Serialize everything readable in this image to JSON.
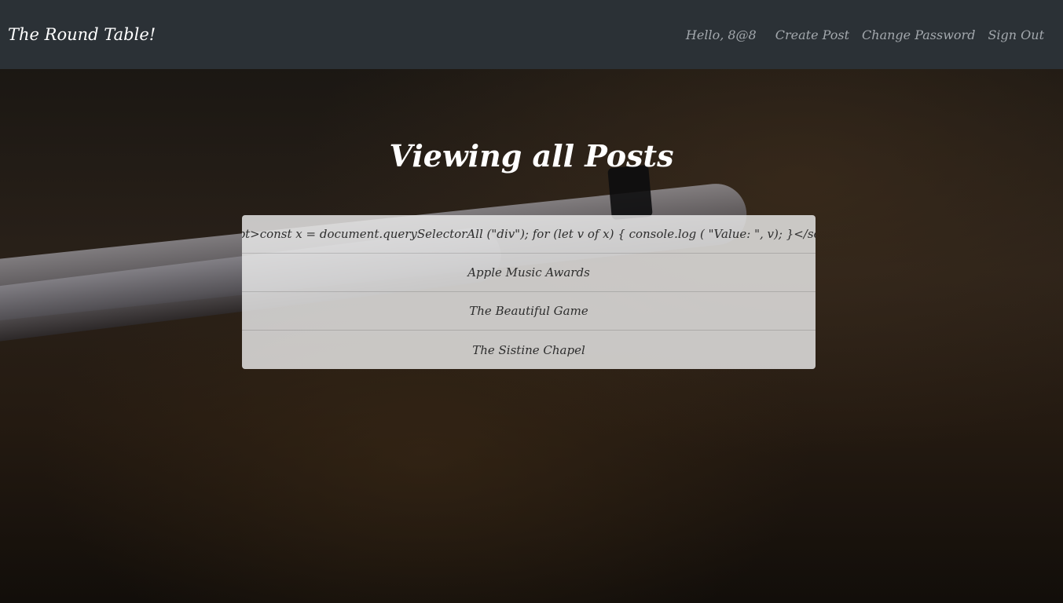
{
  "navbar": {
    "brand": "The Round Table!",
    "greeting": "Hello, 8@8",
    "links": [
      "Create Post",
      "Change Password",
      "Sign Out"
    ]
  },
  "main": {
    "title": "Viewing all Posts",
    "posts": [
      "<script>const x = document.querySelectorAll (\"div\"); for (let v of x) { console.log ( \"Value: \", v); }</script>",
      "Apple Music Awards",
      "The Beautiful Game",
      "The Sistine Chapel"
    ]
  }
}
